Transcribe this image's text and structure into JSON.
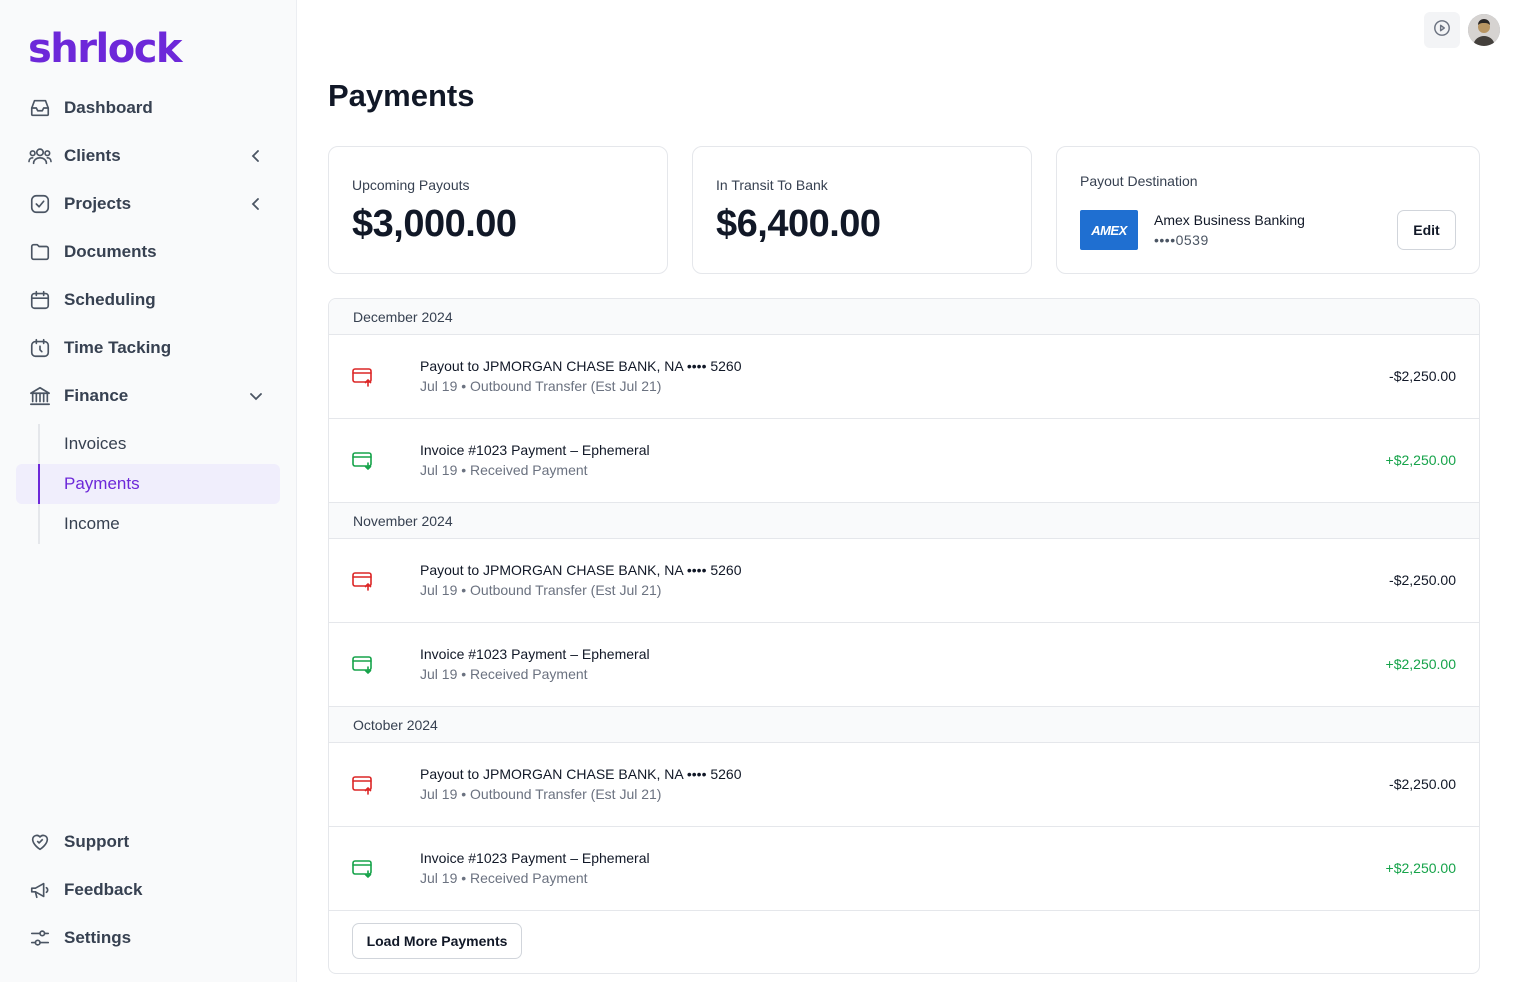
{
  "app": {
    "logo_text": "shrlock",
    "brand_color": "#6d28d9"
  },
  "sidebar": {
    "items": [
      {
        "label": "Dashboard",
        "icon": "inbox-icon"
      },
      {
        "label": "Clients",
        "icon": "users-icon",
        "expandable": true
      },
      {
        "label": "Projects",
        "icon": "check-square-icon",
        "expandable": true
      },
      {
        "label": "Documents",
        "icon": "folder-icon"
      },
      {
        "label": "Scheduling",
        "icon": "calendar-icon"
      },
      {
        "label": "Time Tacking",
        "icon": "timer-icon"
      },
      {
        "label": "Finance",
        "icon": "bank-icon",
        "expanded": true
      }
    ],
    "finance_sub": [
      {
        "label": "Invoices"
      },
      {
        "label": "Payments",
        "active": true
      },
      {
        "label": "Income"
      }
    ],
    "bottom": [
      {
        "label": "Support",
        "icon": "heart-handshake-icon"
      },
      {
        "label": "Feedback",
        "icon": "megaphone-icon"
      },
      {
        "label": "Settings",
        "icon": "sliders-icon"
      }
    ]
  },
  "topbar": {
    "play_icon": "play-circle-icon"
  },
  "page": {
    "title": "Payments"
  },
  "cards": {
    "upcoming": {
      "label": "Upcoming Payouts",
      "value": "$3,000.00"
    },
    "transit": {
      "label": "In Transit To Bank",
      "value": "$6,400.00"
    },
    "destination": {
      "label": "Payout Destination",
      "card_brand": "AMEX",
      "bank_name": "Amex Business Banking",
      "account": "••••0539",
      "edit_label": "Edit"
    }
  },
  "groups": [
    {
      "month": "December 2024",
      "rows": [
        {
          "type": "out",
          "title": "Payout to JPMORGAN CHASE BANK, NA •••• 5260",
          "sub": "Jul 19 • Outbound Transfer (Est Jul 21)",
          "amount": "-$2,250.00"
        },
        {
          "type": "in",
          "title": "Invoice #1023 Payment – Ephemeral",
          "sub": "Jul 19 • Received Payment",
          "amount": "+$2,250.00"
        }
      ]
    },
    {
      "month": "November 2024",
      "rows": [
        {
          "type": "out",
          "title": "Payout to JPMORGAN CHASE BANK, NA •••• 5260",
          "sub": "Jul 19 • Outbound Transfer (Est Jul 21)",
          "amount": "-$2,250.00"
        },
        {
          "type": "in",
          "title": "Invoice #1023 Payment – Ephemeral",
          "sub": "Jul 19 • Received Payment",
          "amount": "+$2,250.00"
        }
      ]
    },
    {
      "month": "October 2024",
      "rows": [
        {
          "type": "out",
          "title": "Payout to JPMORGAN CHASE BANK, NA •••• 5260",
          "sub": "Jul 19 • Outbound Transfer (Est Jul 21)",
          "amount": "-$2,250.00"
        },
        {
          "type": "in",
          "title": "Invoice #1023 Payment – Ephemeral",
          "sub": "Jul 19 • Received Payment",
          "amount": "+$2,250.00"
        }
      ]
    }
  ],
  "load_more_label": "Load More Payments",
  "colors": {
    "positive": "#16a34a",
    "negative_icon": "#dc2626",
    "positive_icon": "#16a34a"
  }
}
